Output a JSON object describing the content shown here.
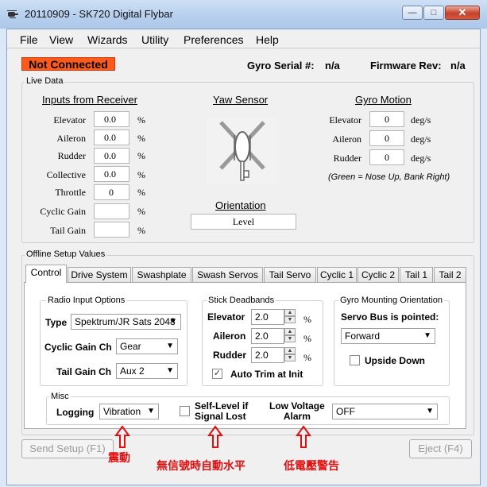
{
  "window": {
    "title": "20110909 - SK720 Digital Flybar"
  },
  "menu": [
    "File",
    "View",
    "Wizards",
    "Utility",
    "Preferences",
    "Help"
  ],
  "status": {
    "connection": "Not Connected",
    "gyro_serial_label": "Gyro Serial #:",
    "gyro_serial_value": "n/a",
    "firmware_label": "Firmware Rev:",
    "firmware_value": "n/a"
  },
  "live_data": {
    "title": "Live Data",
    "inputs": {
      "title": "Inputs from Receiver",
      "rows": [
        {
          "label": "Elevator",
          "value": "0.0",
          "unit": "%"
        },
        {
          "label": "Aileron",
          "value": "0.0",
          "unit": "%"
        },
        {
          "label": "Rudder",
          "value": "0.0",
          "unit": "%"
        },
        {
          "label": "Collective",
          "value": "0.0",
          "unit": "%"
        },
        {
          "label": "Throttle",
          "value": "0",
          "unit": "%"
        },
        {
          "label": "Cyclic Gain",
          "value": "",
          "unit": "%"
        },
        {
          "label": "Tail Gain",
          "value": "",
          "unit": "%"
        }
      ]
    },
    "yaw": {
      "title": "Yaw Sensor",
      "orientation_title": "Orientation",
      "orientation_value": "Level"
    },
    "gyro": {
      "title": "Gyro Motion",
      "rows": [
        {
          "label": "Elevator",
          "value": "0",
          "unit": "deg/s"
        },
        {
          "label": "Aileron",
          "value": "0",
          "unit": "deg/s"
        },
        {
          "label": "Rudder",
          "value": "0",
          "unit": "deg/s"
        }
      ],
      "note": "(Green = Nose Up, Bank Right)"
    }
  },
  "offline": {
    "title": "Offline Setup Values",
    "tabs": [
      "Control",
      "Drive System",
      "Swashplate",
      "Swash Servos",
      "Tail Servo",
      "Cyclic 1",
      "Cyclic 2",
      "Tail 1",
      "Tail 2"
    ],
    "radio": {
      "title": "Radio Input Options",
      "type_label": "Type",
      "type_value": "Spektrum/JR Sats 2048",
      "cyclic_label": "Cyclic Gain Ch",
      "cyclic_value": "Gear",
      "tail_label": "Tail Gain Ch",
      "tail_value": "Aux 2"
    },
    "deadbands": {
      "title": "Stick Deadbands",
      "rows": [
        {
          "label": "Elevator",
          "value": "2.0",
          "unit": "%"
        },
        {
          "label": "Aileron",
          "value": "2.0",
          "unit": "%"
        },
        {
          "label": "Rudder",
          "value": "2.0",
          "unit": "%"
        }
      ],
      "auto_trim_label": "Auto Trim at Init",
      "auto_trim_checked": true
    },
    "mounting": {
      "title": "Gyro Mounting Orientation",
      "servo_label": "Servo Bus is pointed:",
      "servo_value": "Forward",
      "upside_down_label": "Upside Down",
      "upside_down_checked": false
    },
    "misc": {
      "title": "Misc",
      "logging_label": "Logging",
      "logging_value": "Vibration",
      "self_level_line1": "Self-Level if",
      "self_level_line2": "Signal Lost",
      "low_voltage_line1": "Low Voltage",
      "low_voltage_line2": "Alarm",
      "low_voltage_value": "OFF"
    }
  },
  "buttons": {
    "send": "Send Setup (F1)",
    "eject": "Eject (F4)"
  },
  "annotations": [
    "震動",
    "無信號時自動水平",
    "低電壓警告"
  ],
  "colors": {
    "status_bg": "#ff5a1a",
    "annotation": "#e01010"
  }
}
